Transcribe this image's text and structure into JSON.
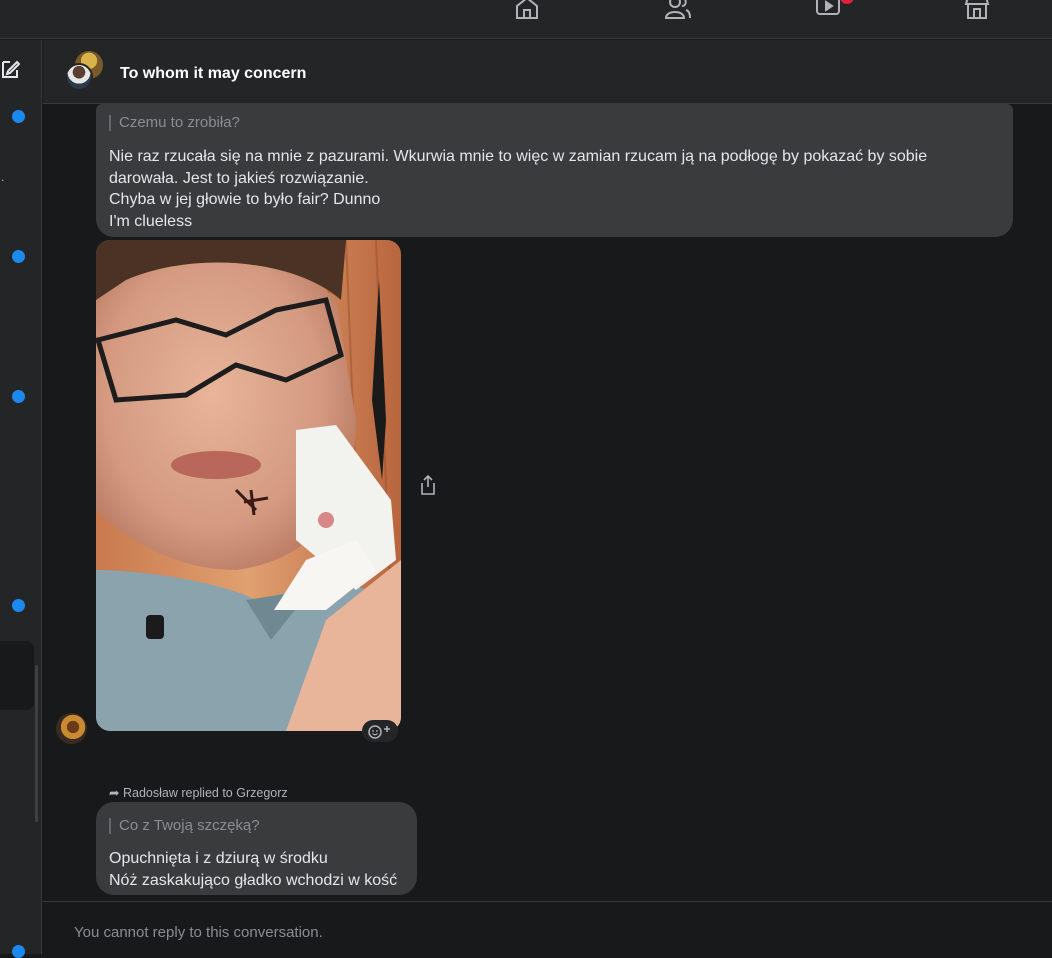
{
  "topbar": {
    "icons": [
      "home-icon",
      "friends-icon",
      "watch-icon",
      "marketplace-icon"
    ]
  },
  "conversation": {
    "title": "To whom it may concern"
  },
  "messages": {
    "first": {
      "quoted": "Czemu to zrobiła?",
      "lines": [
        "Nie raz rzucała się na mnie z pazurami. Wkurwia mnie to więc w zamian rzucam ją na podłogę by pokazać by sobie",
        "darowała. Jest to jakieś rozwiązanie.",
        "Chyba w jej głowie to było fair? Dunno",
        "I'm clueless"
      ]
    },
    "reply": {
      "meta": "Radosław replied to Grzegorz",
      "quoted": "Co z Twoją szczęką?",
      "lines": [
        "Opuchnięta i z dziurą w środku",
        "Nóż zaskakująco gładko wchodzi w kość"
      ]
    }
  },
  "footer": {
    "notice": "You cannot reply to this conversation."
  },
  "colors": {
    "accent": "#1b8af0",
    "notification": "#e41e3f",
    "bubble": "#3a3b3c",
    "background": "#18191a"
  }
}
